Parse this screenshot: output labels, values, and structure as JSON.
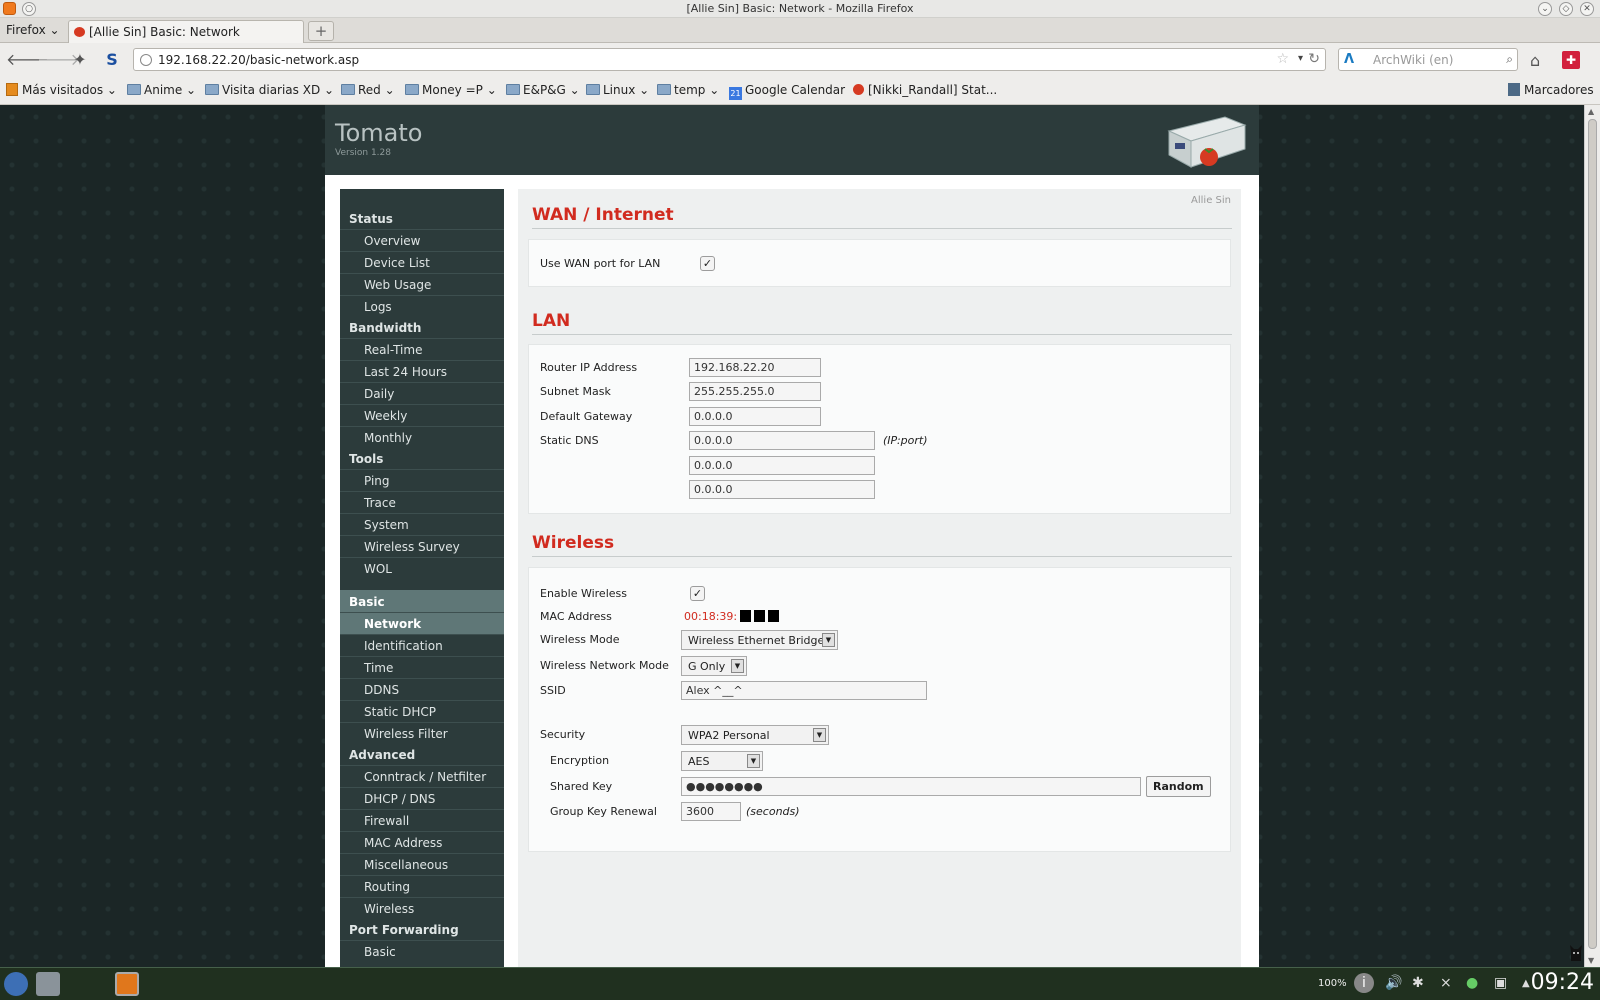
{
  "window": {
    "title": "[Allie Sin] Basic: Network - Mozilla Firefox"
  },
  "browser": {
    "menu_label": "Firefox",
    "tab_title": "[Allie Sin] Basic: Network",
    "url": "192.168.22.20/basic-network.asp",
    "search_placeholder": "ArchWiki (en)",
    "bookmarks": [
      "Más visitados",
      "Anime",
      "Visita diarias XD",
      "Red",
      "Money =P",
      "E&P&G",
      "Linux",
      "temp",
      "Google Calendar",
      "[Nikki_Randall] Stat...",
      "Marcadores"
    ],
    "calendar_icon_text": "21"
  },
  "header": {
    "brand": "Tomato",
    "version": "Version 1.28"
  },
  "user_name": "Allie Sin",
  "sidebar": {
    "sections": [
      {
        "title": "Status",
        "items": [
          "Overview",
          "Device List",
          "Web Usage",
          "Logs"
        ]
      },
      {
        "title": "Bandwidth",
        "items": [
          "Real-Time",
          "Last 24 Hours",
          "Daily",
          "Weekly",
          "Monthly"
        ]
      },
      {
        "title": "Tools",
        "items": [
          "Ping",
          "Trace",
          "System",
          "Wireless Survey",
          "WOL"
        ]
      },
      {
        "title": "Basic",
        "items": [
          "Network",
          "Identification",
          "Time",
          "DDNS",
          "Static DHCP",
          "Wireless Filter"
        ]
      },
      {
        "title": "Advanced",
        "items": [
          "Conntrack / Netfilter",
          "DHCP / DNS",
          "Firewall",
          "MAC Address",
          "Miscellaneous",
          "Routing",
          "Wireless"
        ]
      },
      {
        "title": "Port Forwarding",
        "items": [
          "Basic"
        ]
      }
    ],
    "active_section": "Basic",
    "active_item": "Network"
  },
  "wan": {
    "title": "WAN / Internet",
    "use_wan_for_lan_label": "Use WAN port for LAN",
    "use_wan_for_lan_checked": true
  },
  "lan": {
    "title": "LAN",
    "router_ip_label": "Router IP Address",
    "router_ip": "192.168.22.20",
    "subnet_label": "Subnet Mask",
    "subnet": "255.255.255.0",
    "gateway_label": "Default Gateway",
    "gateway": "0.0.0.0",
    "dns_label": "Static DNS",
    "dns": [
      "0.0.0.0",
      "0.0.0.0",
      "0.0.0.0"
    ],
    "dns_note": "(IP:port)"
  },
  "wireless": {
    "title": "Wireless",
    "enable_label": "Enable Wireless",
    "enable_checked": true,
    "mac_label": "MAC Address",
    "mac_prefix": "00:18:39:",
    "mode_label": "Wireless Mode",
    "mode": "Wireless Ethernet Bridge",
    "net_mode_label": "Wireless Network Mode",
    "net_mode": "G Only",
    "ssid_label": "SSID",
    "ssid": "Alex ^__^",
    "security_label": "Security",
    "security": "WPA2 Personal",
    "encryption_label": "Encryption",
    "encryption": "AES",
    "shared_key_label": "Shared Key",
    "shared_key": "●●●●●●●●",
    "random_label": "Random",
    "renewal_label": "Group Key Renewal",
    "renewal": "3600",
    "renewal_note": "(seconds)"
  },
  "taskbar": {
    "clock": "09:24",
    "zoom": "100%"
  },
  "colors": {
    "accent_red": "#d12b1f",
    "nav_bg": "#2c3b3b",
    "nav_active": "#5f7777"
  }
}
